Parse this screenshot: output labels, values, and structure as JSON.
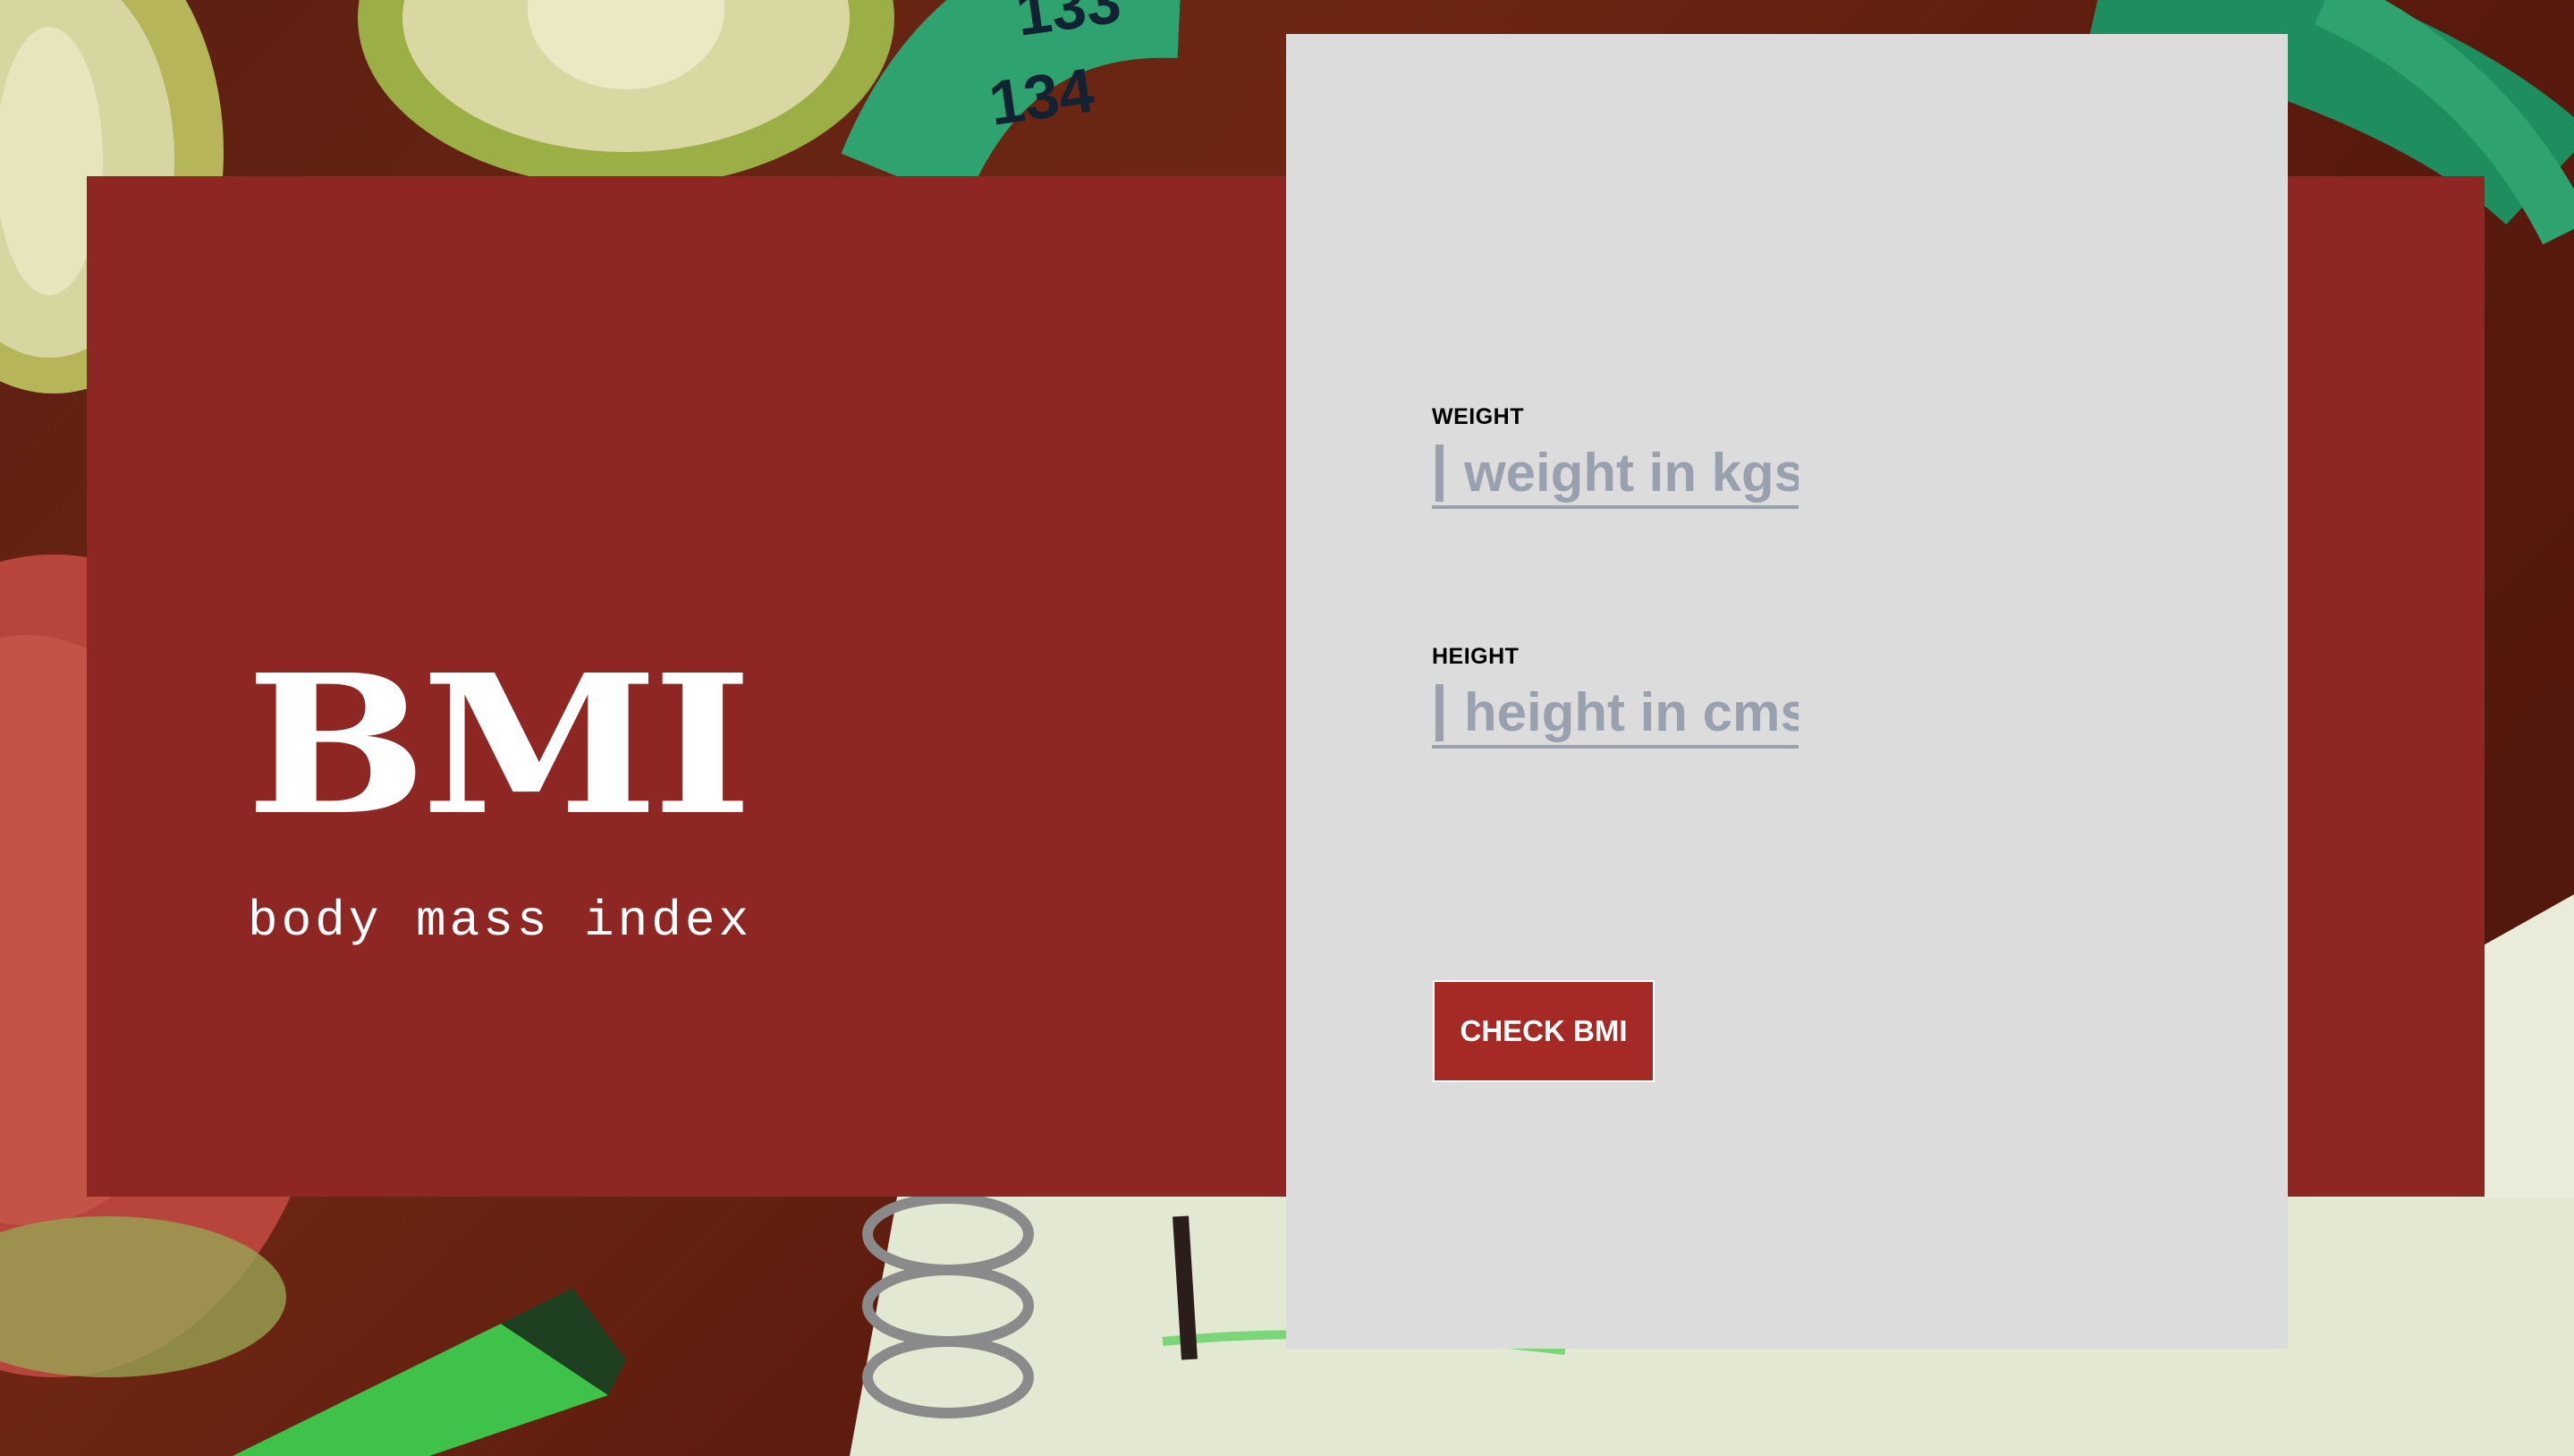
{
  "hero": {
    "title": "BMI",
    "subtitle": "body mass index"
  },
  "form": {
    "weight": {
      "label": "WEIGHT",
      "placeholder": "weight in kgs",
      "value": ""
    },
    "height": {
      "label": "HEIGHT",
      "placeholder": "height in cms",
      "value": ""
    },
    "submit_label": "CHECK BMI"
  },
  "colors": {
    "hero_red": "#8e2723",
    "button_red": "#a52a26",
    "card_gray": "#dcdcdc",
    "input_accent": "#9aa1ae"
  },
  "background": {
    "description_icons": [
      "kiwi-slice",
      "measuring-tape",
      "apple",
      "notebook-spiral",
      "green-marker"
    ]
  }
}
